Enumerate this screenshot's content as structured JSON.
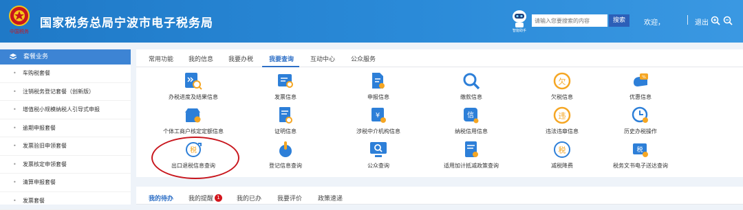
{
  "header": {
    "site_title": "国家税务总局宁波市电子税务局",
    "emblem_caption": "中国税务",
    "search_placeholder": "请输入您要搜索的内容",
    "search_button": "搜索",
    "welcome": "欢迎，",
    "logout": "退出",
    "robot_label": "智能助手",
    "colors": {
      "bar": "#2a8ad8",
      "search_button": "#2c5fb8"
    }
  },
  "sidebar": {
    "title": "套餐业务",
    "items": [
      "车购税套餐",
      "注销税务登记套餐（创新版）",
      "增值税小规模纳税人引导式申报",
      "逾期申报套餐",
      "发票验旧申领套餐",
      "发票核定申领套餐",
      "清算申报套餐",
      "发票套餐"
    ]
  },
  "tabs": [
    "常用功能",
    "我的信息",
    "我要办税",
    "我要查询",
    "互动中心",
    "公众服务"
  ],
  "active_tab": "我要查询",
  "services": [
    {
      "label": "办税进度及结果信息",
      "icon": "progress-search-icon"
    },
    {
      "label": "发票信息",
      "icon": "invoice-icon"
    },
    {
      "label": "申报信息",
      "icon": "declaration-icon"
    },
    {
      "label": "缴款信息",
      "icon": "magnifier-icon"
    },
    {
      "label": "欠税信息",
      "icon": "tax-owed-icon"
    },
    {
      "label": "优惠信息",
      "icon": "discount-icon"
    },
    {
      "label": "个体工商户核定定额信息",
      "icon": "merchant-icon"
    },
    {
      "label": "证明信息",
      "icon": "certificate-icon"
    },
    {
      "label": "涉税中介机构信息",
      "icon": "agency-icon"
    },
    {
      "label": "纳税信用信息",
      "icon": "credit-icon"
    },
    {
      "label": "违法违章信息",
      "icon": "violation-icon"
    },
    {
      "label": "历史办税操作",
      "icon": "history-clock-icon"
    },
    {
      "label": "出口退税信息查询",
      "icon": "export-rebate-icon"
    },
    {
      "label": "登记信息查询",
      "icon": "registration-icon"
    },
    {
      "label": "公众查询",
      "icon": "monitor-search-icon"
    },
    {
      "label": "适用加计抵减政策查询",
      "icon": "policy-icon"
    },
    {
      "label": "减税降费",
      "icon": "tax-reduction-icon"
    },
    {
      "label": "税务文书电子送达查询",
      "icon": "document-delivery-icon"
    }
  ],
  "bottom_tabs": [
    "我的待办",
    "我的提醒",
    "我的已办",
    "我要评价",
    "政策速递"
  ],
  "active_bottom_tab": "我的待办",
  "reminder_badge": "1",
  "icon_colors": {
    "blue": "#2d7fd8",
    "orange": "#f5a623"
  }
}
